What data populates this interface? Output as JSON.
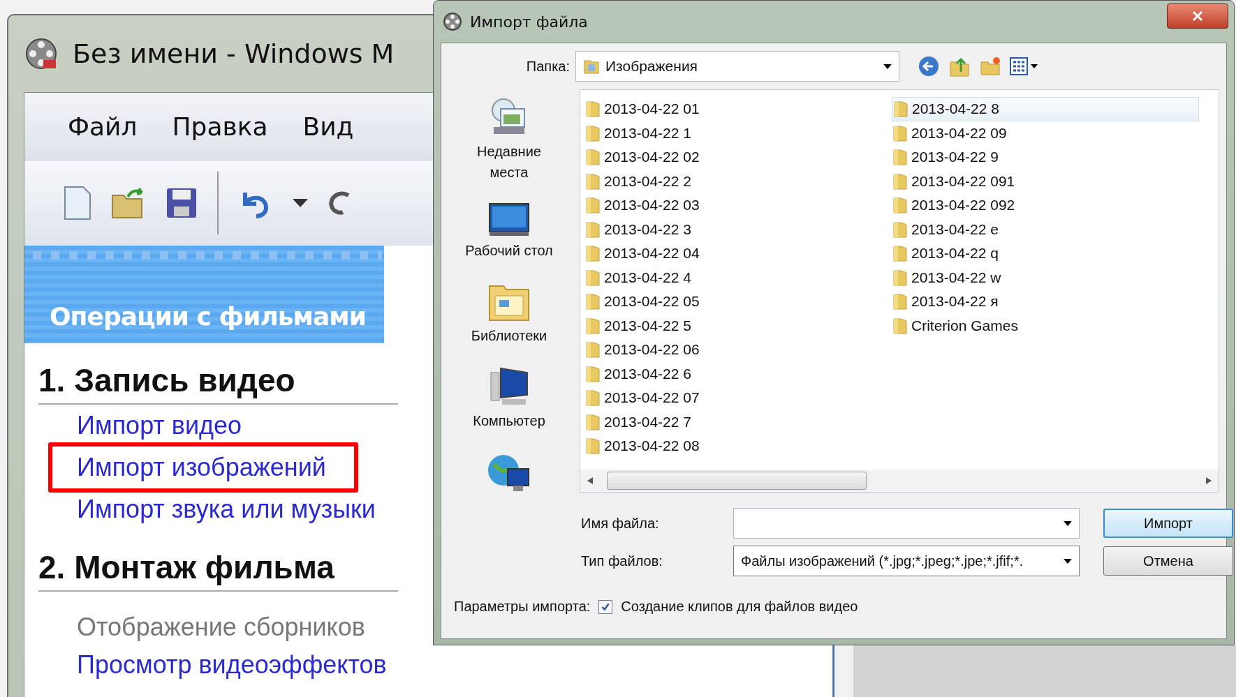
{
  "movie_maker": {
    "title": "Без имени - Windows M",
    "menu": [
      "Файл",
      "Правка",
      "Вид"
    ]
  },
  "task_pane": {
    "title": "Операции с фильмами",
    "sections": [
      {
        "heading": "1. Запись видео",
        "links": [
          {
            "label": "Импорт видео",
            "disabled": false,
            "highlighted": false
          },
          {
            "label": "Импорт изображений",
            "disabled": false,
            "highlighted": true
          },
          {
            "label": "Импорт звука или музыки",
            "disabled": false,
            "highlighted": false
          }
        ]
      },
      {
        "heading": "2. Монтаж фильма",
        "links": [
          {
            "label": "Отображение сборников",
            "disabled": true,
            "highlighted": false
          },
          {
            "label": "Просмотр видеоэффектов",
            "disabled": false,
            "highlighted": false
          }
        ]
      }
    ]
  },
  "dialog": {
    "title": "Импорт файла",
    "folder_label": "Папка:",
    "folder": "Изображения",
    "places": [
      {
        "kind": "recent",
        "label": "Недавние места"
      },
      {
        "kind": "desktop",
        "label": "Рабочий стол"
      },
      {
        "kind": "libraries",
        "label": "Библиотеки"
      },
      {
        "kind": "computer",
        "label": "Компьютер"
      },
      {
        "kind": "network"
      }
    ],
    "files": [
      {
        "name": "2013-04-22 01",
        "selected": false
      },
      {
        "name": "2013-04-22 1",
        "selected": false
      },
      {
        "name": "2013-04-22 02",
        "selected": false
      },
      {
        "name": "2013-04-22 2",
        "selected": false
      },
      {
        "name": "2013-04-22 03",
        "selected": false
      },
      {
        "name": "2013-04-22 3",
        "selected": false
      },
      {
        "name": "2013-04-22 04",
        "selected": false
      },
      {
        "name": "2013-04-22 4",
        "selected": false
      },
      {
        "name": "2013-04-22 05",
        "selected": false
      },
      {
        "name": "2013-04-22 5",
        "selected": false
      },
      {
        "name": "2013-04-22 06",
        "selected": false
      },
      {
        "name": "2013-04-22 6",
        "selected": false
      },
      {
        "name": "2013-04-22 07",
        "selected": false
      },
      {
        "name": "2013-04-22 7",
        "selected": false
      },
      {
        "name": "2013-04-22 08",
        "selected": false
      },
      {
        "name": "2013-04-22 8",
        "selected": true
      },
      {
        "name": "2013-04-22 09",
        "selected": false
      },
      {
        "name": "2013-04-22 9",
        "selected": false
      },
      {
        "name": "2013-04-22 091",
        "selected": false
      },
      {
        "name": "2013-04-22 092",
        "selected": false
      },
      {
        "name": "2013-04-22 e",
        "selected": false
      },
      {
        "name": "2013-04-22 q",
        "selected": false
      },
      {
        "name": "2013-04-22 w",
        "selected": false
      },
      {
        "name": "2013-04-22 я",
        "selected": false
      },
      {
        "name": "Criterion Games",
        "selected": false
      }
    ],
    "file_name_label": "Имя файла:",
    "file_type_label": "Тип файлов:",
    "file_type": "Файлы изображений (*.jpg;*.jpeg;*.jpe;*.jfif;*.",
    "buttons": [
      {
        "label": "Импорт",
        "default": true
      },
      {
        "label": "Отмена",
        "default": false
      }
    ],
    "import_options_label": "Параметры импорта:",
    "create_clips": {
      "label": "Создание клипов для файлов видео",
      "checked": true
    }
  }
}
